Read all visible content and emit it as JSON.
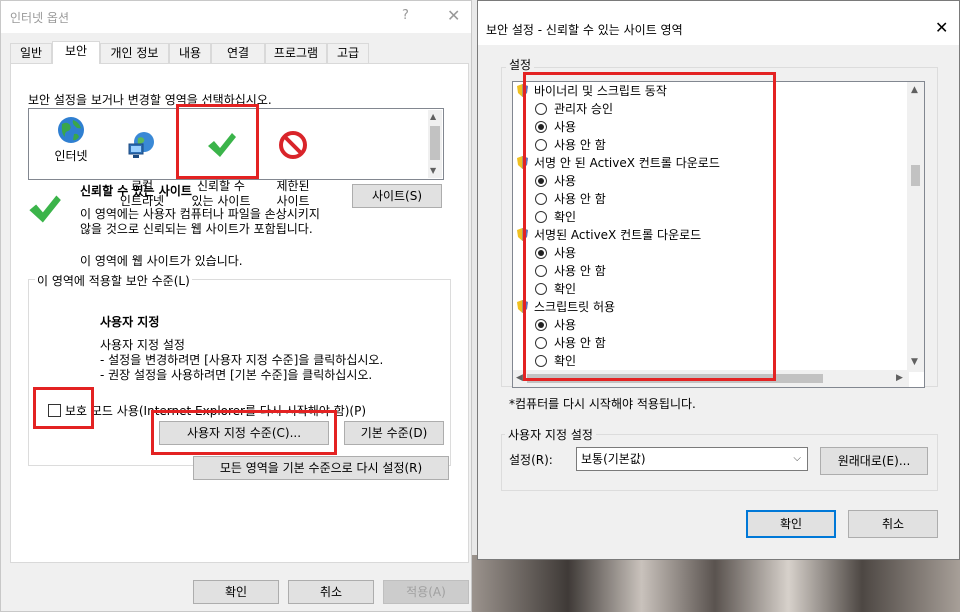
{
  "internet_options": {
    "title": "인터넷 옵션",
    "help_glyph": "?",
    "close_glyph": "✕",
    "tabs": [
      {
        "label": "일반"
      },
      {
        "label": "보안"
      },
      {
        "label": "개인 정보"
      },
      {
        "label": "내용"
      },
      {
        "label": "연결"
      },
      {
        "label": "프로그램"
      },
      {
        "label": "고급"
      }
    ],
    "instruction": "보안 설정을 보거나 변경할 영역을 선택하십시오.",
    "zones": [
      {
        "label": "인터넷",
        "icon": "globe-icon"
      },
      {
        "label": "로컬\n인트라넷",
        "icon": "intranet-globe-icon"
      },
      {
        "label": "신뢰할 수\n있는 사이트",
        "icon": "checkmark-icon"
      },
      {
        "label": "제한된\n사이트",
        "icon": "restricted-icon"
      }
    ],
    "zone_title": "신뢰할 수 있는 사이트",
    "zone_desc_1": "이 영역에는 사용자 컴퓨터나 파일을 손상시키지",
    "zone_desc_2": "않을 것으로 신뢰되는 웹 사이트가 포함됩니다.",
    "zone_has_sites": "이 영역에 웹 사이트가 있습니다.",
    "sites_button": "사이트(S)",
    "level_group_label": "이 영역에 적용할 보안 수준(L)",
    "level_title": "사용자 지정",
    "level_desc_1": "사용자 지정 설정",
    "level_desc_2": "- 설정을 변경하려면 [사용자 지정 수준]을 클릭하십시오.",
    "level_desc_3": "- 권장 설정을 사용하려면 [기본 수준]을 클릭하십시오.",
    "protected_mode_label": "보호 모드 사용(Internet Explorer를 다시 시작해야 함)(P)",
    "custom_level_button": "사용자 지정 수준(C)...",
    "default_level_button": "기본 수준(D)",
    "reset_all_button": "모든 영역을 기본 수준으로 다시 설정(R)",
    "ok_button": "확인",
    "cancel_button": "취소",
    "apply_button": "적용(A)"
  },
  "security_settings": {
    "title": "보안 설정 - 신뢰할 수 있는 사이트 영역",
    "close_glyph": "✕",
    "settings_label": "설정",
    "items": [
      {
        "kind": "header",
        "text": "바이너리 및 스크립트 동작"
      },
      {
        "kind": "option",
        "text": "관리자 승인",
        "selected": false
      },
      {
        "kind": "option",
        "text": "사용",
        "selected": true
      },
      {
        "kind": "option",
        "text": "사용 안 함",
        "selected": false
      },
      {
        "kind": "header",
        "text": "서명 안 된 ActiveX 컨트롤 다운로드"
      },
      {
        "kind": "option",
        "text": "사용",
        "selected": true
      },
      {
        "kind": "option",
        "text": "사용 안 함",
        "selected": false
      },
      {
        "kind": "option",
        "text": "확인",
        "selected": false
      },
      {
        "kind": "header",
        "text": "서명된 ActiveX 컨트롤 다운로드"
      },
      {
        "kind": "option",
        "text": "사용",
        "selected": true
      },
      {
        "kind": "option",
        "text": "사용 안 함",
        "selected": false
      },
      {
        "kind": "option",
        "text": "확인",
        "selected": false
      },
      {
        "kind": "header",
        "text": "스크립트릿 허용"
      },
      {
        "kind": "option",
        "text": "사용",
        "selected": true
      },
      {
        "kind": "option",
        "text": "사용 안 함",
        "selected": false
      },
      {
        "kind": "option",
        "text": "확인",
        "selected": false
      }
    ],
    "restart_note": "*컴퓨터를 다시 시작해야 적용됩니다.",
    "custom_group_label": "사용자 지정 설정",
    "reset_to_label": "설정(R):",
    "reset_to_value": "보통(기본값)",
    "reset_button": "원래대로(E)...",
    "ok_button": "확인",
    "cancel_button": "취소"
  },
  "colors": {
    "highlight_red": "#e32222",
    "focus_blue": "#0078d7"
  }
}
